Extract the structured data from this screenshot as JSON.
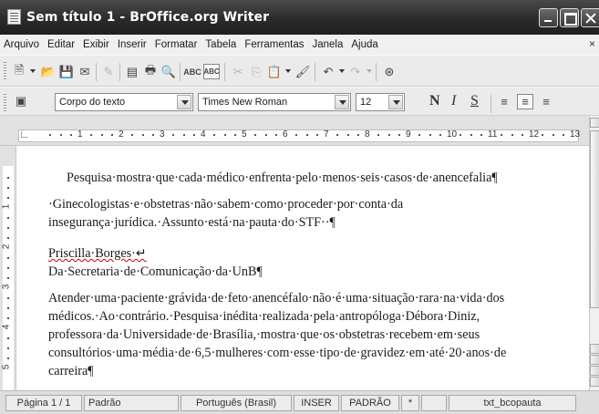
{
  "window": {
    "title": "Sem título 1 - BrOffice.org Writer"
  },
  "menu": {
    "items": [
      "Arquivo",
      "Editar",
      "Exibir",
      "Inserir",
      "Formatar",
      "Tabela",
      "Ferramentas",
      "Janela",
      "Ajuda"
    ],
    "close_glyph": "×"
  },
  "toolbar_standard": {
    "icons": [
      "new-icon",
      "open-icon",
      "save-icon",
      "email-icon",
      "edit-file-icon",
      "export-pdf-icon",
      "print-icon",
      "page-preview-icon",
      "spellcheck-icon",
      "autospellcheck-icon",
      "cut-icon",
      "copy-icon",
      "paste-icon",
      "clone-format-icon",
      "undo-icon",
      "redo-icon",
      "navigator-icon"
    ]
  },
  "toolbar_format": {
    "paragraph_style": "Corpo do texto",
    "font_name": "Times New Roman",
    "font_size": "12",
    "bold_label": "N",
    "italic_label": "I",
    "underline_label": "S"
  },
  "ruler": {
    "labels": [
      "1",
      "2",
      "3",
      "4",
      "5",
      "6",
      "7",
      "8",
      "9",
      "10",
      "11",
      "12",
      "13"
    ]
  },
  "vruler": {
    "labels": [
      "1",
      "2",
      "3",
      "4",
      "5"
    ]
  },
  "document": {
    "paragraphs": [
      "Pesquisa·mostra·que·cada·médico·enfrenta·pelo·menos·seis·casos·de·anencefalia¶",
      "·Ginecologistas·e·obstetras·não·sabem·como·proceder·por·conta·da",
      "insegurança·jurídica.·Assunto·está·na·pauta·do·STF··¶",
      "Priscilla·Borges·↵",
      "Da·Secretaria·de·Comunicação·da·UnB¶",
      "Atender·uma·paciente·grávida·de·feto·anencéfalo·não·é·uma·situação·rara·na·vida·dos",
      "médicos.·Ao·contrário.·Pesquisa·inédita·realizada·pela·antropóloga·Débora·Diniz,",
      "professora·da·Universidade·de·Brasília,·mostra·que·os·obstetras·recebem·em·seus",
      "consultórios·uma·média·de·6,5·mulheres·com·esse·tipo·de·gravidez·em·até·20·anos·de",
      "carreira¶"
    ]
  },
  "statusbar": {
    "page": "Página 1 / 1",
    "page_style": "Padrão",
    "language": "Português (Brasil)",
    "insert_mode": "INSER",
    "selection_mode": "PADRÃO",
    "modified": "*",
    "signature": "",
    "section": "txt_bcopauta"
  }
}
